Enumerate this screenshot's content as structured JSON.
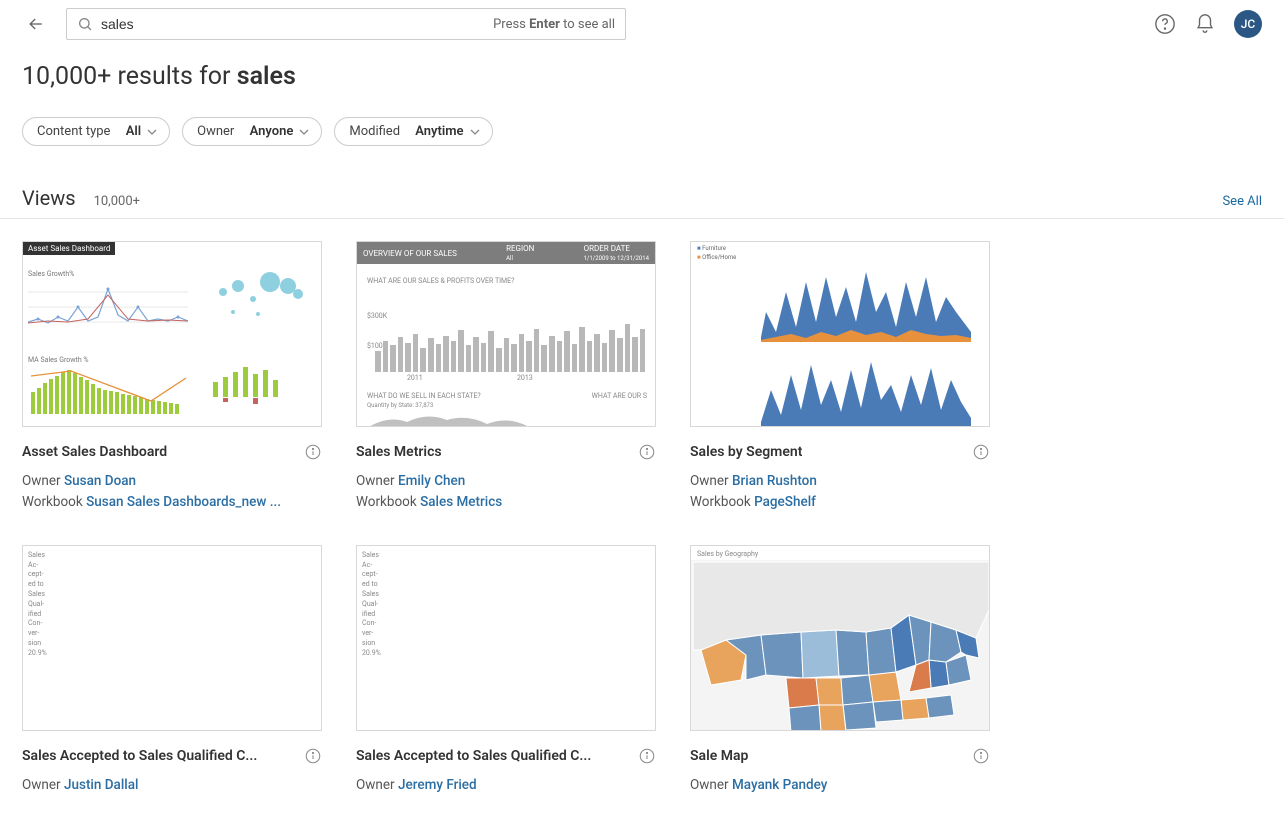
{
  "search": {
    "value": "sales",
    "hint_prefix": "Press ",
    "hint_bold": "Enter",
    "hint_suffix": " to see all"
  },
  "avatar": "JC",
  "results_heading": {
    "prefix": "10,000+ results for ",
    "term": "sales"
  },
  "filters": [
    {
      "label": "Content type",
      "value": "All"
    },
    {
      "label": "Owner",
      "value": "Anyone"
    },
    {
      "label": "Modified",
      "value": "Anytime"
    }
  ],
  "section": {
    "title": "Views",
    "count": "10,000+",
    "see_all": "See All"
  },
  "meta_labels": {
    "owner": "Owner",
    "workbook": "Workbook"
  },
  "cards": [
    {
      "title": "Asset Sales Dashboard",
      "owner": "Susan Doan",
      "workbook": "Susan Sales Dashboards_new ..."
    },
    {
      "title": "Sales Metrics",
      "owner": "Emily Chen",
      "workbook": "Sales Metrics"
    },
    {
      "title": "Sales by Segment",
      "owner": "Brian Rushton",
      "workbook": "PageShelf"
    },
    {
      "title": "Sales Accepted to Sales Qualified C...",
      "owner": "Justin Dallal"
    },
    {
      "title": "Sales Accepted to Sales Qualified C...",
      "owner": "Jeremy Fried"
    },
    {
      "title": "Sale Map",
      "owner": "Mayank Pandey"
    }
  ],
  "thumbs": {
    "t1": {
      "banner": "Asset Sales Dashboard",
      "labels": [
        "Sales Growth%",
        "MA Sales Growth %"
      ]
    },
    "t2": {
      "header_left": "OVERVIEW OF OUR SALES",
      "header_mid": "REGION",
      "header_mid_val": "All",
      "header_right": "ORDER DATE",
      "header_right_val": "1/1/2009 to 12/31/2014",
      "q1": "WHAT ARE OUR SALES & PROFITS OVER TIME?",
      "y1": "$300K",
      "y2": "$100K",
      "x1": "2011",
      "x2": "2013",
      "q2": "WHAT DO WE SELL IN EACH STATE?",
      "q2sub": "Quantity by State: 37,873",
      "q3": "WHAT ARE OUR S"
    },
    "t3": {
      "legend1": "Furniture",
      "legend2": "Office/Home"
    },
    "t45": {
      "lines": [
        "Sales",
        "Ac-",
        "cept-",
        "ed to",
        "Sales",
        "Qual-",
        "ified",
        "Con-",
        "ver-",
        "sion",
        "20.9%"
      ]
    },
    "t6": {
      "title": "Sales by Geography"
    }
  }
}
